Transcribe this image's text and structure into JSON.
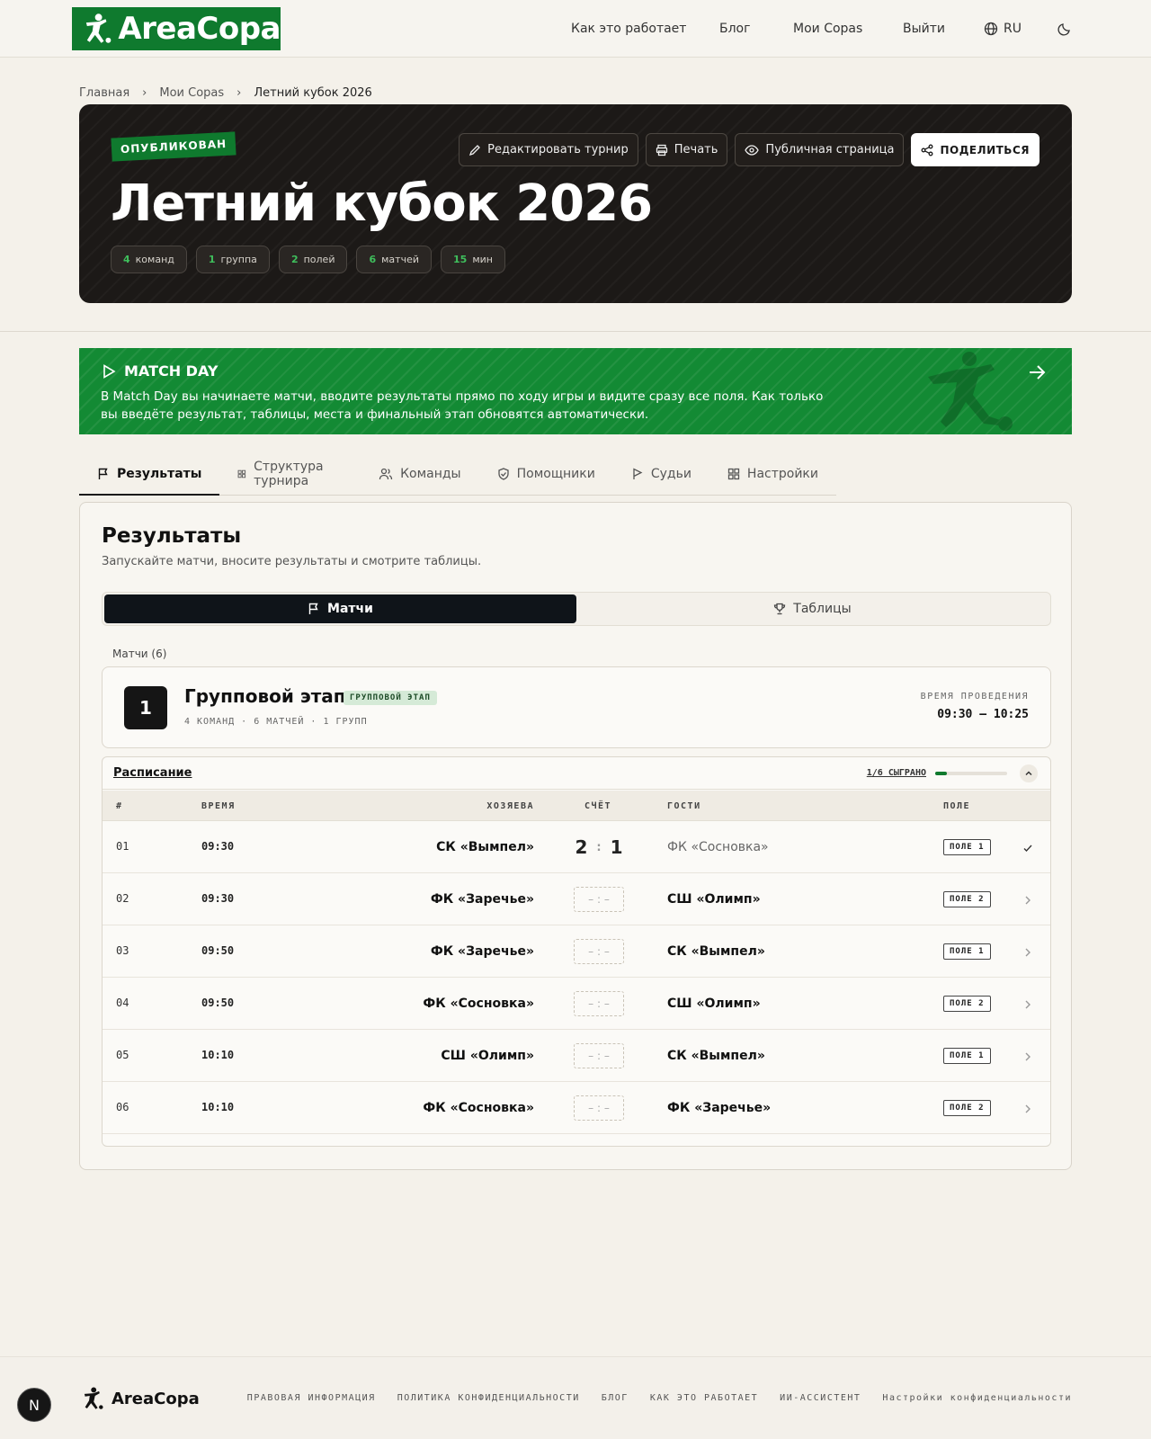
{
  "header": {
    "logo_text": "AreaCopa",
    "nav": [
      "Как это работает",
      "Блог",
      "Мои Copas",
      "Выйти"
    ],
    "lang": "RU"
  },
  "breadcrumb": [
    "Главная",
    "Мои Copas",
    "Летний кубок 2026"
  ],
  "hero": {
    "status": "ОПУБЛИКОВАН",
    "title": "Летний кубок 2026",
    "chips": [
      {
        "n": "4",
        "label": "команд"
      },
      {
        "n": "1",
        "label": "группа"
      },
      {
        "n": "2",
        "label": "полей"
      },
      {
        "n": "6",
        "label": "матчей"
      },
      {
        "n": "15",
        "label": "мин"
      }
    ],
    "buttons": {
      "edit": "Редактировать турнир",
      "print": "Печать",
      "public": "Публичная страница",
      "share": "ПОДЕЛИТЬСЯ"
    }
  },
  "matchday": {
    "title": "MATCH DAY",
    "text": "В Match Day вы начинаете матчи, вводите результаты прямо по ходу игры и видите сразу все поля. Как только вы введёте результат, таблицы, места и финальный этап обновятся автоматически."
  },
  "tabs": [
    "Результаты",
    "Структура турнира",
    "Команды",
    "Помощники",
    "Судьи",
    "Настройки"
  ],
  "results": {
    "title": "Результаты",
    "subtitle": "Запускайте матчи, вносите результаты и смотрите таблицы.",
    "segments": [
      "Матчи",
      "Таблицы"
    ],
    "matches_count": "Матчи (6)",
    "stage": {
      "number": "1",
      "name": "Групповой этап",
      "tag": "ГРУППОВОЙ ЭТАП",
      "meta": "4 КОМАНД · 6 МАТЧЕЙ · 1 ГРУПП",
      "time_label": "ВРЕМЯ ПРОВЕДЕНИЯ",
      "time_value": "09:30 – 10:25"
    },
    "schedule": {
      "link": "Расписание",
      "progress_text": "1/6 СЫГРАНО",
      "progress": 0.1667,
      "columns": [
        "#",
        "ВРЕМЯ",
        "ХОЗЯЕВА",
        "СЧЁТ",
        "ГОСТИ",
        "ПОЛЕ"
      ],
      "rows": [
        {
          "idx": "01",
          "time": "09:30",
          "home": "СК «Вымпел»",
          "home_score": "2",
          "away_score": "1",
          "away": "ФК «Сосновка»",
          "field": "ПОЛЕ 1"
        },
        {
          "idx": "02",
          "time": "09:30",
          "home": "ФК «Заречье»",
          "score": "– : –",
          "away": "СШ «Олимп»",
          "field": "ПОЛЕ 2"
        },
        {
          "idx": "03",
          "time": "09:50",
          "home": "ФК «Заречье»",
          "score": "– : –",
          "away": "СК «Вымпел»",
          "field": "ПОЛЕ 1"
        },
        {
          "idx": "04",
          "time": "09:50",
          "home": "ФК «Сосновка»",
          "score": "– : –",
          "away": "СШ «Олимп»",
          "field": "ПОЛЕ 2"
        },
        {
          "idx": "05",
          "time": "10:10",
          "home": "СШ «Олимп»",
          "score": "– : –",
          "away": "СК «Вымпел»",
          "field": "ПОЛЕ 1"
        },
        {
          "idx": "06",
          "time": "10:10",
          "home": "ФК «Сосновка»",
          "score": "– : –",
          "away": "ФК «Заречье»",
          "field": "ПОЛЕ 2"
        }
      ]
    }
  },
  "footer": {
    "logo_text": "AreaCopa",
    "links": [
      "ПРАВОВАЯ ИНФОРМАЦИЯ",
      "ПОЛИТИКА КОНФИДЕНЦИАЛЬНОСТИ",
      "БЛОГ",
      "КАК ЭТО РАБОТАЕТ",
      "ИИ-АССИСТЕНТ",
      "Настройки конфиденциальности"
    ]
  },
  "dev_badge": "N",
  "colors": {
    "brand_green": "#0f7a2e",
    "hero_dark": "#1c1917",
    "banner_green": "#138a34"
  }
}
